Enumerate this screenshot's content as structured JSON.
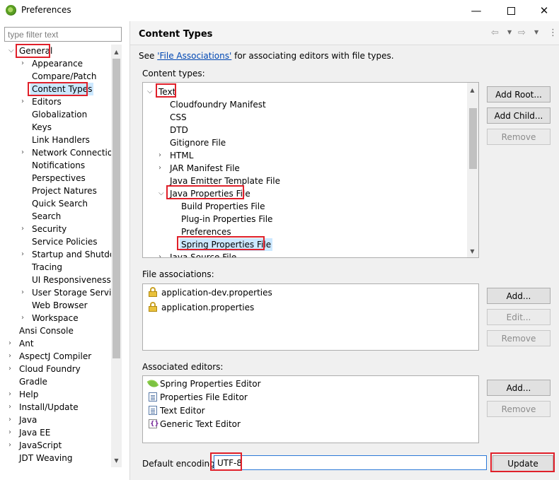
{
  "window": {
    "title": "Preferences",
    "minimize": "—",
    "close": "✕"
  },
  "filter": {
    "placeholder": "type filter text"
  },
  "tree": {
    "items": [
      {
        "label": "General",
        "indent": 0,
        "arrow": "expanded"
      },
      {
        "label": "Appearance",
        "indent": 1,
        "arrow": "collapsed"
      },
      {
        "label": "Compare/Patch",
        "indent": 1,
        "arrow": "none"
      },
      {
        "label": "Content Types",
        "indent": 1,
        "arrow": "none",
        "selected": true
      },
      {
        "label": "Editors",
        "indent": 1,
        "arrow": "collapsed"
      },
      {
        "label": "Globalization",
        "indent": 1,
        "arrow": "none"
      },
      {
        "label": "Keys",
        "indent": 1,
        "arrow": "none"
      },
      {
        "label": "Link Handlers",
        "indent": 1,
        "arrow": "none"
      },
      {
        "label": "Network Connections",
        "indent": 1,
        "arrow": "collapsed"
      },
      {
        "label": "Notifications",
        "indent": 1,
        "arrow": "none"
      },
      {
        "label": "Perspectives",
        "indent": 1,
        "arrow": "none"
      },
      {
        "label": "Project Natures",
        "indent": 1,
        "arrow": "none"
      },
      {
        "label": "Quick Search",
        "indent": 1,
        "arrow": "none"
      },
      {
        "label": "Search",
        "indent": 1,
        "arrow": "none"
      },
      {
        "label": "Security",
        "indent": 1,
        "arrow": "collapsed"
      },
      {
        "label": "Service Policies",
        "indent": 1,
        "arrow": "none"
      },
      {
        "label": "Startup and Shutdown",
        "indent": 1,
        "arrow": "collapsed"
      },
      {
        "label": "Tracing",
        "indent": 1,
        "arrow": "none"
      },
      {
        "label": "UI Responsiveness Monitoring",
        "indent": 1,
        "arrow": "none"
      },
      {
        "label": "User Storage Service",
        "indent": 1,
        "arrow": "collapsed"
      },
      {
        "label": "Web Browser",
        "indent": 1,
        "arrow": "none"
      },
      {
        "label": "Workspace",
        "indent": 1,
        "arrow": "collapsed"
      },
      {
        "label": "Ansi Console",
        "indent": 0,
        "arrow": "none"
      },
      {
        "label": "Ant",
        "indent": 0,
        "arrow": "collapsed"
      },
      {
        "label": "AspectJ Compiler",
        "indent": 0,
        "arrow": "collapsed"
      },
      {
        "label": "Cloud Foundry",
        "indent": 0,
        "arrow": "collapsed"
      },
      {
        "label": "Gradle",
        "indent": 0,
        "arrow": "none"
      },
      {
        "label": "Help",
        "indent": 0,
        "arrow": "collapsed"
      },
      {
        "label": "Install/Update",
        "indent": 0,
        "arrow": "collapsed"
      },
      {
        "label": "Java",
        "indent": 0,
        "arrow": "collapsed"
      },
      {
        "label": "Java EE",
        "indent": 0,
        "arrow": "collapsed"
      },
      {
        "label": "JavaScript",
        "indent": 0,
        "arrow": "collapsed"
      },
      {
        "label": "JDT Weaving",
        "indent": 0,
        "arrow": "none"
      }
    ]
  },
  "page": {
    "title": "Content Types",
    "see_prefix": "See ",
    "see_link": "'File Associations'",
    "see_suffix": " for associating editors with file types."
  },
  "content_types": {
    "label": "Content types:",
    "items": [
      {
        "label": "Text",
        "indent": 0,
        "arrow": "expanded"
      },
      {
        "label": "Cloudfoundry Manifest",
        "indent": 1,
        "arrow": "none"
      },
      {
        "label": "CSS",
        "indent": 1,
        "arrow": "none"
      },
      {
        "label": "DTD",
        "indent": 1,
        "arrow": "none"
      },
      {
        "label": "Gitignore File",
        "indent": 1,
        "arrow": "none"
      },
      {
        "label": "HTML",
        "indent": 1,
        "arrow": "collapsed"
      },
      {
        "label": "JAR Manifest File",
        "indent": 1,
        "arrow": "collapsed"
      },
      {
        "label": "Java Emitter Template File",
        "indent": 1,
        "arrow": "none"
      },
      {
        "label": "Java Properties File",
        "indent": 1,
        "arrow": "expanded"
      },
      {
        "label": "Build Properties File",
        "indent": 2,
        "arrow": "none"
      },
      {
        "label": "Plug-in Properties File",
        "indent": 2,
        "arrow": "none"
      },
      {
        "label": "Preferences",
        "indent": 2,
        "arrow": "none"
      },
      {
        "label": "Spring Properties File",
        "indent": 2,
        "arrow": "none",
        "selected": true
      },
      {
        "label": "Java Source File",
        "indent": 1,
        "arrow": "collapsed"
      }
    ],
    "buttons": {
      "add_root": "Add Root...",
      "add_child": "Add Child...",
      "remove": "Remove"
    }
  },
  "file_associations": {
    "label": "File associations:",
    "items": [
      "application-dev.properties",
      "application.properties"
    ],
    "buttons": {
      "add": "Add...",
      "edit": "Edit...",
      "remove": "Remove"
    }
  },
  "associated_editors": {
    "label": "Associated editors:",
    "items": [
      {
        "label": "Spring Properties Editor",
        "icon": "spring-leaf-icon"
      },
      {
        "label": "Properties File Editor",
        "icon": "properties-file-icon"
      },
      {
        "label": "Text Editor",
        "icon": "text-file-icon"
      },
      {
        "label": "Generic Text Editor",
        "icon": "generic-editor-icon"
      }
    ],
    "buttons": {
      "add": "Add...",
      "remove": "Remove"
    }
  },
  "encoding": {
    "label": "Default encoding:",
    "value": "UTF-8",
    "update": "Update"
  },
  "colors": {
    "highlight": "#e0202a",
    "link": "#0047b3",
    "selection": "#cce8ff"
  }
}
